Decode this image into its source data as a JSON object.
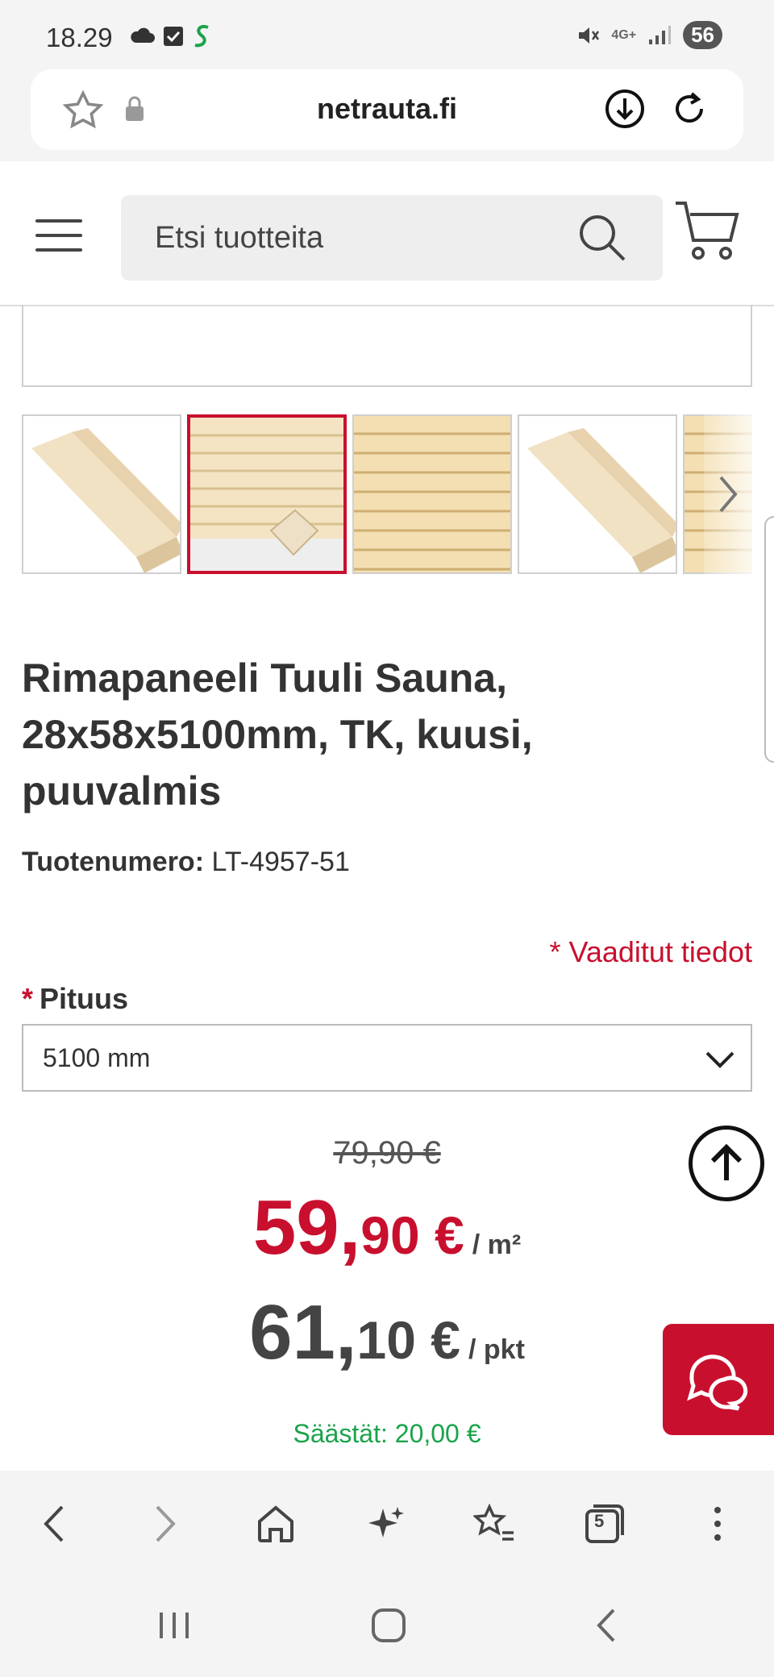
{
  "status_bar": {
    "time": "18.29",
    "battery": "56",
    "network": "4G+"
  },
  "browser": {
    "url": "netrauta.fi",
    "tab_count": "5"
  },
  "header": {
    "search_placeholder": "Etsi tuotteita"
  },
  "gallery": {
    "thumbnails": [
      {
        "name": "thumb-panel-profile",
        "active": false
      },
      {
        "name": "thumb-wall-panel",
        "active": true
      },
      {
        "name": "thumb-wall-close",
        "active": false
      },
      {
        "name": "thumb-panel-profile-2",
        "active": false
      },
      {
        "name": "thumb-wall-partial",
        "active": false
      }
    ]
  },
  "product": {
    "title": "Rimapaneeli Tuuli Sauna, 28x58x5100mm, TK, kuusi, puuvalmis",
    "sku_label": "Tuotenumero:",
    "sku_value": "LT-4957-51",
    "required_note": "* Vaaditut tiedot",
    "length_required_mark": "*",
    "length_label": "Pituus",
    "length_value": "5100 mm"
  },
  "pricing": {
    "old_price": "79,90 €",
    "price_int": "59,",
    "price_dec": "90 €",
    "price_unit": "/ m²",
    "pkt_int": "61,",
    "pkt_dec": "10 €",
    "pkt_unit": "/ pkt",
    "savings": "Säästät: 20,00 €"
  },
  "colors": {
    "accent": "#c8102e",
    "savings": "#1aa34a",
    "text": "#333333"
  }
}
